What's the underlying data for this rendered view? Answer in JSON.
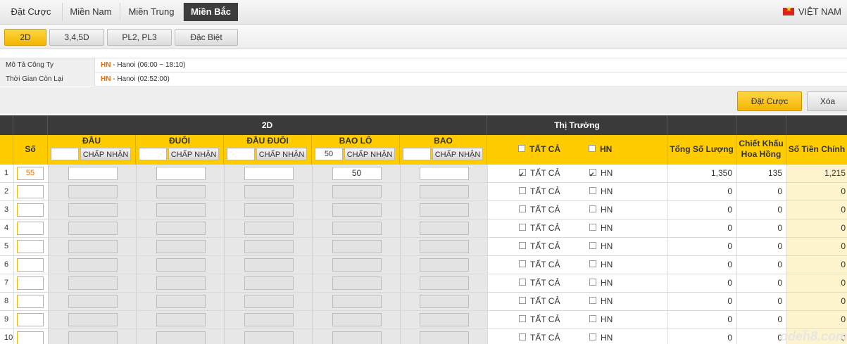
{
  "nav": {
    "tabs": [
      "Đặt Cược",
      "Miền Nam",
      "Miền Trung",
      "Miền Bắc"
    ],
    "active": 3,
    "language": "VIỆT NAM"
  },
  "subtabs": {
    "items": [
      "2D",
      "3,4,5D",
      "PL2, PL3",
      "Đặc Biệt"
    ],
    "active": 0
  },
  "info": {
    "company_label": "Mô Tả Công Ty",
    "company_code": "HN",
    "company_value": " - Hanoi (06:00 ~ 18:10)",
    "time_label": "Thời Gian Còn Lại",
    "time_code": "HN",
    "time_value": " - Hanoi (02:52:00)"
  },
  "actions": {
    "bet": "Đặt Cược",
    "clear": "Xóa"
  },
  "table": {
    "group_2d": "2D",
    "group_market": "Thị Trường",
    "col_so": "Số",
    "columns": [
      "ĐẦU",
      "ĐUÔI",
      "ĐẦU ĐUÔI",
      "BAO LÔ",
      "BAO"
    ],
    "accept_label": "CHẤP NHẬN",
    "header_values": [
      "",
      "",
      "",
      "50",
      ""
    ],
    "market_all": "TẤT CẢ",
    "market_hn": "HN",
    "col_tong": "Tổng Số Lượng",
    "col_ck_1": "Chiết Khấu",
    "col_ck_2": "Hoa Hồng",
    "col_tien": "Số Tiền Chính",
    "rows": [
      {
        "idx": "1",
        "so": "55",
        "baolo": "50",
        "all": true,
        "hn": true,
        "tong": "1,350",
        "ck": "135",
        "tien": "1,215"
      },
      {
        "idx": "2",
        "so": "",
        "baolo": "",
        "all": false,
        "hn": false,
        "tong": "0",
        "ck": "0",
        "tien": "0"
      },
      {
        "idx": "3",
        "so": "",
        "baolo": "",
        "all": false,
        "hn": false,
        "tong": "0",
        "ck": "0",
        "tien": "0"
      },
      {
        "idx": "4",
        "so": "",
        "baolo": "",
        "all": false,
        "hn": false,
        "tong": "0",
        "ck": "0",
        "tien": "0"
      },
      {
        "idx": "5",
        "so": "",
        "baolo": "",
        "all": false,
        "hn": false,
        "tong": "0",
        "ck": "0",
        "tien": "0"
      },
      {
        "idx": "6",
        "so": "",
        "baolo": "",
        "all": false,
        "hn": false,
        "tong": "0",
        "ck": "0",
        "tien": "0"
      },
      {
        "idx": "7",
        "so": "",
        "baolo": "",
        "all": false,
        "hn": false,
        "tong": "0",
        "ck": "0",
        "tien": "0"
      },
      {
        "idx": "8",
        "so": "",
        "baolo": "",
        "all": false,
        "hn": false,
        "tong": "0",
        "ck": "0",
        "tien": "0"
      },
      {
        "idx": "9",
        "so": "",
        "baolo": "",
        "all": false,
        "hn": false,
        "tong": "0",
        "ck": "0",
        "tien": "0"
      },
      {
        "idx": "10",
        "so": "",
        "baolo": "",
        "all": false,
        "hn": false,
        "tong": "0",
        "ck": "0",
        "tien": "0"
      }
    ]
  },
  "watermark": "odeh8.com",
  "colors": {
    "accent": "#ffcc00",
    "dark": "#3a3a3a",
    "code": "#e46c0a"
  }
}
